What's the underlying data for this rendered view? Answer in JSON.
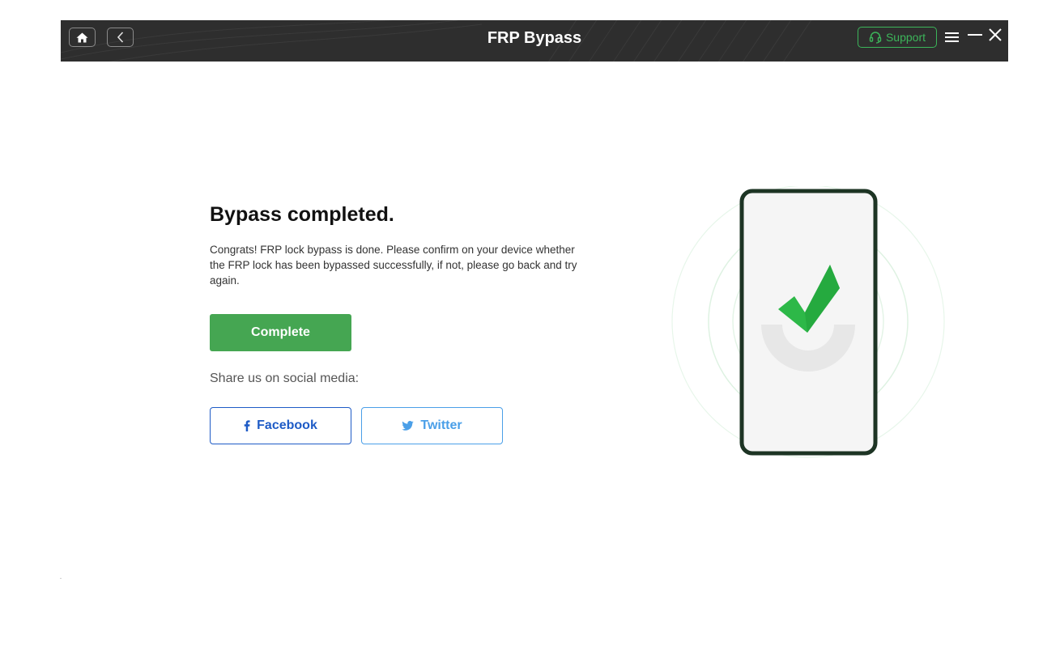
{
  "titlebar": {
    "title": "FRP Bypass",
    "support_label": "Support",
    "icons": [
      "home-icon",
      "back-chevron-icon",
      "headset-icon",
      "menu-icon",
      "minimize-icon",
      "close-icon"
    ]
  },
  "main": {
    "heading": "Bypass completed.",
    "description": "Congrats! FRP lock bypass is done. Please confirm on your device whether the FRP lock has been bypassed successfully, if not, please go back and try again.",
    "complete_label": "Complete",
    "share_label": "Share us on social media:",
    "facebook_label": "Facebook",
    "twitter_label": "Twitter"
  },
  "colors": {
    "titlebar_bg": "#2e2e2e",
    "accent_green": "#45a652",
    "support_green": "#3cb55a",
    "facebook_blue": "#1e5bc6",
    "twitter_blue": "#4a9fe8"
  }
}
